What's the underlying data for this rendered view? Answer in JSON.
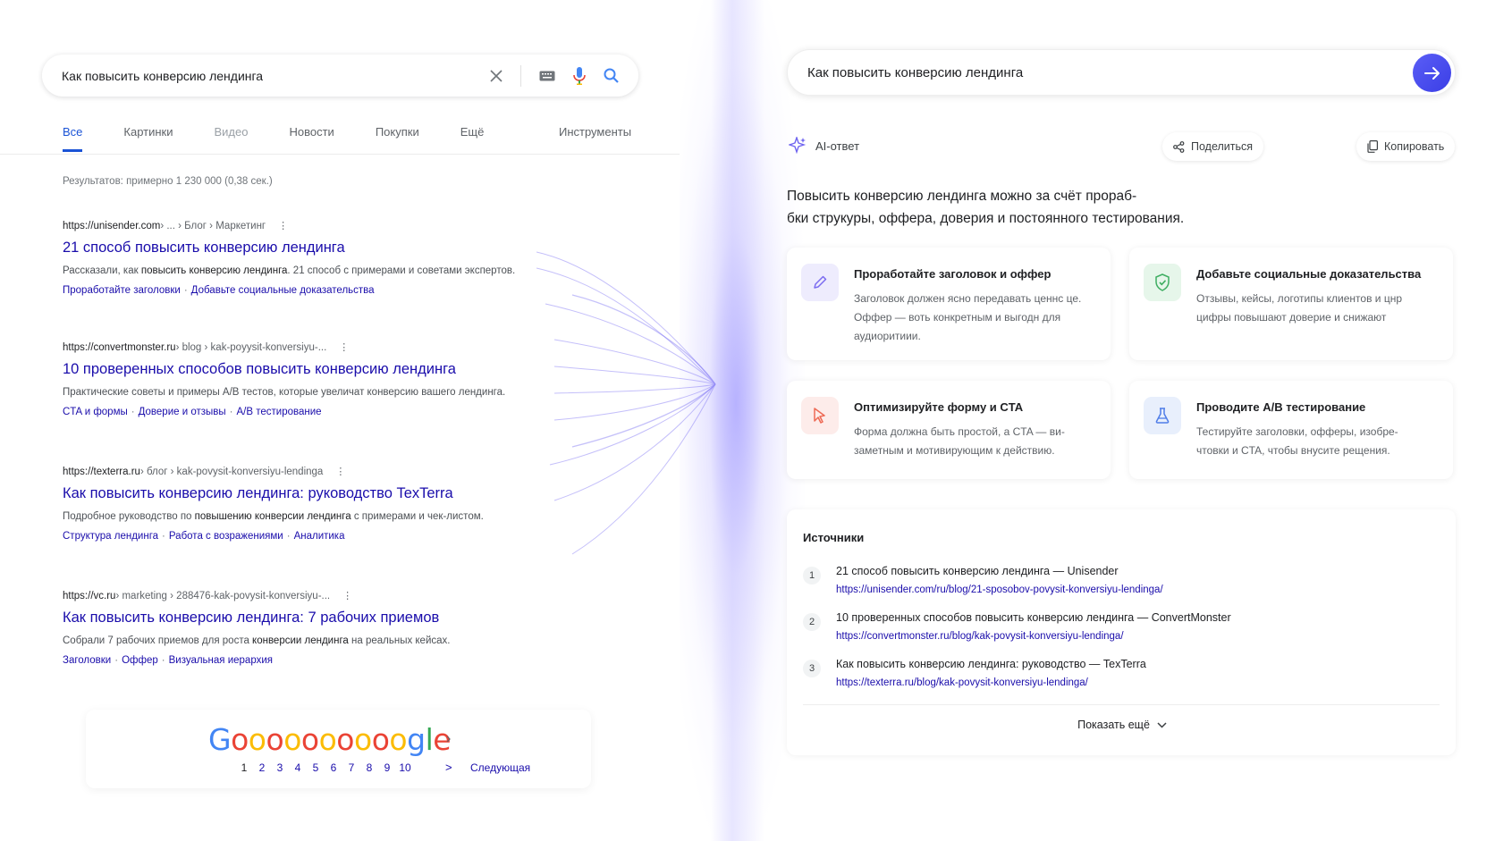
{
  "left": {
    "search": {
      "query": "Как повысить конверсию лендинга"
    },
    "tabs": [
      {
        "label": "Все",
        "state": "active"
      },
      {
        "label": "Картинки",
        "state": "normal"
      },
      {
        "label": "Видео",
        "state": "dim"
      },
      {
        "label": "Новости",
        "state": "normal"
      },
      {
        "label": "Покупки",
        "state": "normal"
      },
      {
        "label": "Ещё",
        "state": "normal"
      }
    ],
    "tools_label": "Инструменты",
    "stats": "Результатов: примерно 1 230 000 (0,38 сек.)",
    "results": [
      {
        "domain": "https://unisender.com",
        "path": " › ... › Блог › Маркетинг",
        "title": "21 способ повысить конверсию лендинга",
        "snippet_pre": "Рассказали, как ",
        "snippet_bold": "повысить конверсию лендинга",
        "snippet_post": ". 21 способ с примерами и советами экспертов.",
        "links": [
          "Проработайте заголовки",
          "Добавьте социальные доказательства"
        ]
      },
      {
        "domain": "https://convertmonster.ru",
        "path": " › blog › kak-poyysit-konversiyu-...",
        "title": "10 проверенных способов повысить конверсию лендинга",
        "snippet_pre": "Практические советы и примеры A/B тестов, которые увеличат конверсию вашего лендинга.",
        "snippet_bold": "",
        "snippet_post": "",
        "links": [
          "CTA и формы",
          "Доверие и отзывы",
          "A/B тестирование"
        ]
      },
      {
        "domain": "https://texterra.ru",
        "path": " › блог › kak-povysit-konversiyu-lendinga",
        "title": "Как повысить конверсию лендинга: руководство TexTerra",
        "snippet_pre": "Подробное руководство по ",
        "snippet_bold": "повышению конверсии лендинга",
        "snippet_post": " с примерами и чек-листом.",
        "links": [
          "Структура лендинга",
          "Работа с возражениями",
          "Аналитика"
        ]
      },
      {
        "domain": "https://vc.ru",
        "path": " › marketing › 288476-kak-povysit-konversiyu-...",
        "title": "Как повысить конверсию лендинга: 7 рабочих приемов",
        "snippet_pre": "Собрали 7 рабочих приемов для роста ",
        "snippet_bold": "конверсии лендинга",
        "snippet_post": " на реальных кейсах.",
        "links": [
          "Заголовки",
          "Оффер",
          "Визуальная иерархия"
        ]
      }
    ],
    "pager": {
      "pages": [
        "1",
        "2",
        "3",
        "4",
        "5",
        "6",
        "7",
        "8",
        "9",
        "10"
      ],
      "current": "1",
      "next_arrow": ">",
      "next_label": "Следующая"
    }
  },
  "right": {
    "search": {
      "query": "Как повысить конверсию лендинга"
    },
    "ai_label": "AI-ответ",
    "share_label": "Поделиться",
    "copy_label": "Копировать",
    "summary_line1": "Повысить конверсию лендинга можно за счёт прораб-",
    "summary_line2": "бки стрyкyры, оффера, доверия и постоянного тестирования.",
    "cards": [
      {
        "title": "Проработайте заголовок и оффер",
        "text": "Заголовок должен ясно передавать ценнс це. Оффер — воть конкретным и выгодн для аудиоритиии.",
        "icon": "pencil-icon",
        "color": "#7b6cf0",
        "bg": "#eeecfd"
      },
      {
        "title": "Добавьте социальные доказательства",
        "text": "Отзывы, кейсы, логотипы клиентов и цнр цифры повышают доверие и снижают",
        "icon": "shield-check-icon",
        "color": "#3fae62",
        "bg": "#e6f6ea"
      },
      {
        "title": "Оптимизируйте форму и CTA",
        "text": "Форма должна быть простой, а CTA — ви- заметным и мотивирующим к действию.",
        "icon": "cursor-icon",
        "color": "#ee6a55",
        "bg": "#fdecea"
      },
      {
        "title": "Проводите A/B тестирование",
        "text": "Тестируйте заголовки, офферы, изобре- чтовки и CTA, чтобы внусите рещения.",
        "icon": "flask-icon",
        "color": "#4f7de8",
        "bg": "#e8effc"
      }
    ],
    "sources": {
      "heading": "Источники",
      "items": [
        {
          "num": "1",
          "title": "21 способ повысить конверсию лендинга — Unisender",
          "url": "https://unisender.com/ru/blog/21-sposobov-povysit-konversiyu-lendinga/"
        },
        {
          "num": "2",
          "title": "10 проверенных способов повысить конверсию лендинга — ConvertMonster",
          "url": "https://convertmonster.ru/blog/kak-povysit-konversiyu-lendinga/"
        },
        {
          "num": "3",
          "title": "Как повысить конверсию лендинга: руководство — TexTerra",
          "url": "https://texterra.ru/blog/kak-povysit-konversiyu-lendinga/"
        }
      ],
      "show_more": "Показать ещё"
    }
  }
}
